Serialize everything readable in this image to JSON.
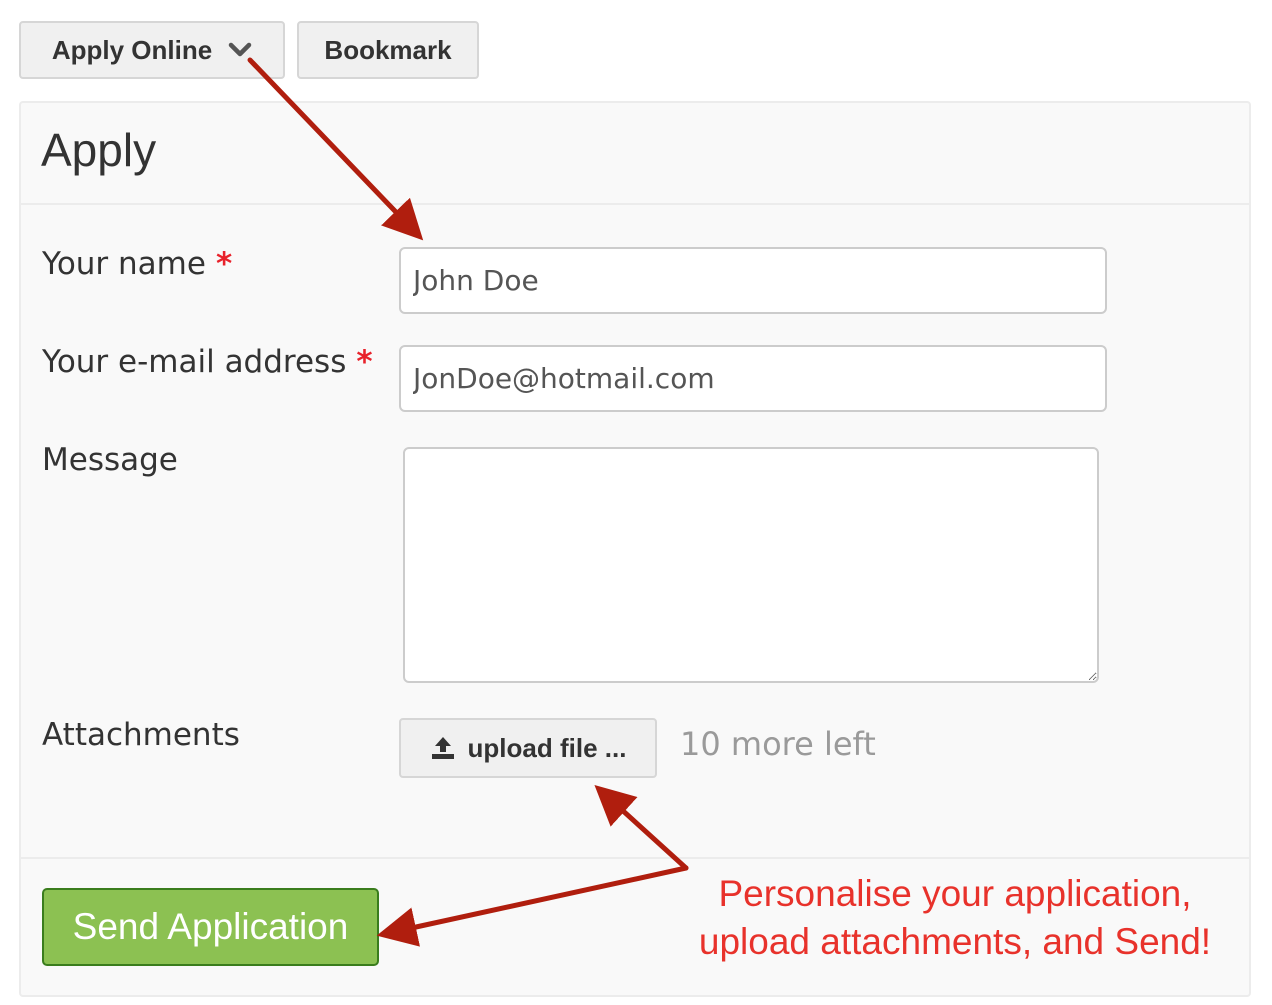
{
  "toolbar": {
    "apply_online_label": "Apply Online",
    "apply_online_icon": "chevron-down-icon",
    "bookmark_label": "Bookmark"
  },
  "form": {
    "title": "Apply",
    "name": {
      "label": "Your name",
      "required_mark": "*",
      "value": "John Doe"
    },
    "email": {
      "label": "Your e-mail address",
      "required_mark": "*",
      "value": "JonDoe@hotmail.com"
    },
    "message": {
      "label": "Message",
      "value": ""
    },
    "attachments": {
      "label": "Attachments",
      "upload_label": "upload file ...",
      "upload_icon": "upload-icon",
      "files_left": "10 more left"
    },
    "submit_label": "Send Application"
  },
  "annotation": {
    "line1": "Personalise your application,",
    "line2": "upload attachments, and Send!",
    "arrow_color": "#b01e0e",
    "text_color": "#e8322b"
  },
  "colors": {
    "accent_green": "#8cc152",
    "required_red": "#e8222b"
  }
}
